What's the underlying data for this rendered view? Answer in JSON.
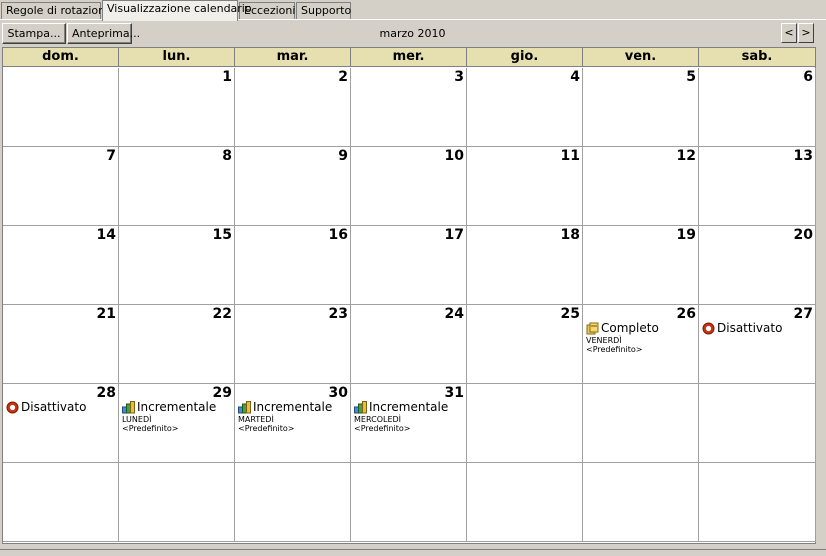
{
  "tabs": [
    {
      "label": "Regole di rotazione"
    },
    {
      "label": "Visualizzazione calendario"
    },
    {
      "label": "Eccezioni"
    },
    {
      "label": "Supporto"
    }
  ],
  "toolbar": {
    "print_label": "Stampa...",
    "preview_label": "Anteprima...",
    "month_title": "marzo 2010",
    "prev_label": "<",
    "next_label": ">"
  },
  "calendar": {
    "weekdays": [
      "dom.",
      "lun.",
      "mar.",
      "mer.",
      "gio.",
      "ven.",
      "sab."
    ],
    "weeks": [
      [
        {
          "day": ""
        },
        {
          "day": "1"
        },
        {
          "day": "2"
        },
        {
          "day": "3"
        },
        {
          "day": "4"
        },
        {
          "day": "5"
        },
        {
          "day": "6"
        }
      ],
      [
        {
          "day": "7"
        },
        {
          "day": "8"
        },
        {
          "day": "9"
        },
        {
          "day": "10"
        },
        {
          "day": "11"
        },
        {
          "day": "12"
        },
        {
          "day": "13"
        }
      ],
      [
        {
          "day": "14"
        },
        {
          "day": "15"
        },
        {
          "day": "16"
        },
        {
          "day": "17"
        },
        {
          "day": "18"
        },
        {
          "day": "19"
        },
        {
          "day": "20"
        }
      ],
      [
        {
          "day": "21"
        },
        {
          "day": "22"
        },
        {
          "day": "23"
        },
        {
          "day": "24"
        },
        {
          "day": "25"
        },
        {
          "day": "26",
          "event": {
            "label": "Completo",
            "icon": "full-backup-icon",
            "sub1": "VENERDÌ",
            "sub2": "<Predefinito>"
          }
        },
        {
          "day": "27",
          "event": {
            "label": "Disattivato",
            "icon": "disabled-icon"
          }
        }
      ],
      [
        {
          "day": "28",
          "event": {
            "label": "Disattivato",
            "icon": "disabled-icon"
          }
        },
        {
          "day": "29",
          "event": {
            "label": "Incrementale",
            "icon": "incremental-backup-icon",
            "sub1": "LUNEDÌ",
            "sub2": "<Predefinito>"
          }
        },
        {
          "day": "30",
          "event": {
            "label": "Incrementale",
            "icon": "incremental-backup-icon",
            "sub1": "MARTEDÌ",
            "sub2": "<Predefinito>"
          }
        },
        {
          "day": "31",
          "event": {
            "label": "Incrementale",
            "icon": "incremental-backup-icon",
            "sub1": "MERCOLEDÌ",
            "sub2": "<Predefinito>"
          }
        },
        {
          "day": ""
        },
        {
          "day": ""
        },
        {
          "day": ""
        }
      ],
      [
        {
          "day": ""
        },
        {
          "day": ""
        },
        {
          "day": ""
        },
        {
          "day": ""
        },
        {
          "day": ""
        },
        {
          "day": ""
        },
        {
          "day": ""
        }
      ]
    ]
  },
  "colors": {
    "header_bg": "#e6e0b0",
    "window_bg": "#d4d0c8",
    "disabled": "#cc3311",
    "full": "#d8b040",
    "incremental": "#3a8a2a"
  }
}
